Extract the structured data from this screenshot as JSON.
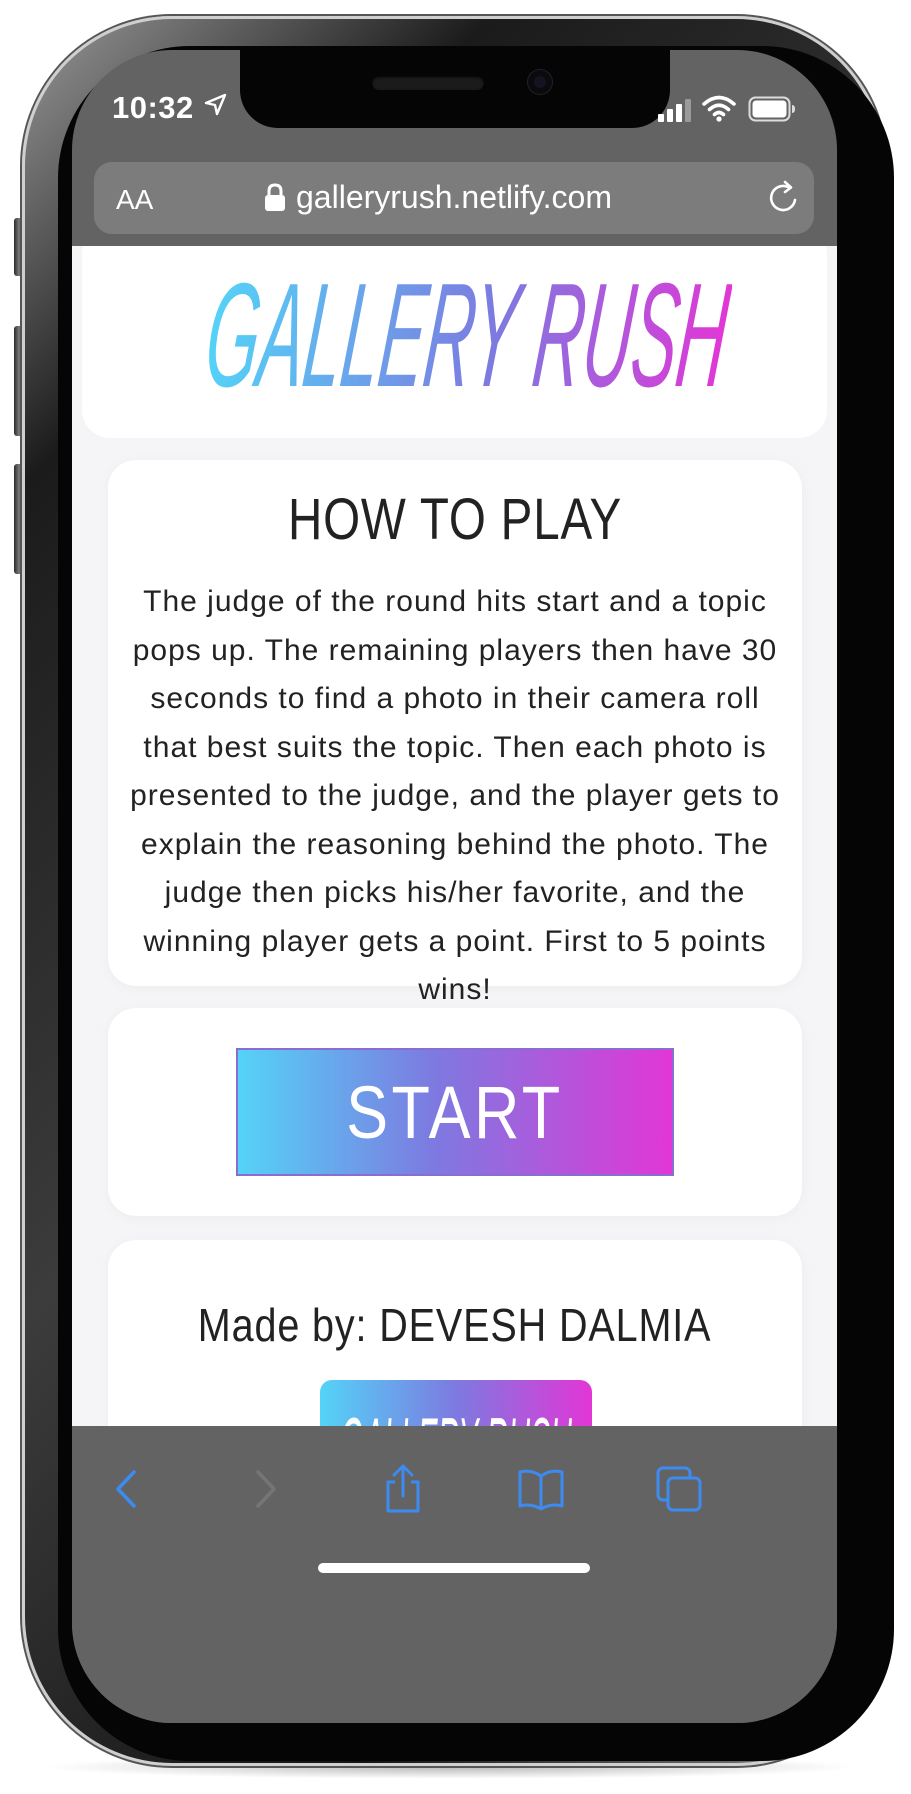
{
  "status_bar": {
    "time": "10:32"
  },
  "browser": {
    "text_size_label": "AA",
    "url": "galleryrush.netlify.com"
  },
  "site": {
    "logo_text": "GALLERY RUSH",
    "how_to_play": {
      "title": "HOW TO PLAY",
      "body": "The judge of the round hits start and a topic pops up. The remaining players then have 30 seconds to find a photo in their camera roll that best suits the topic. Then each photo is presented to the judge, and the player gets to explain the reasoning behind the photo. The judge then picks his/her favorite, and the winning player gets a point. First to 5 points wins!"
    },
    "start_label": "START",
    "credit": "Made by: DEVESH DALMIA",
    "mini_logo_text": "GALLERY RUSH"
  },
  "colors": {
    "gradient_start": "#54d3f7",
    "gradient_mid": "#7d7ae0",
    "gradient_end": "#e236d6",
    "toolbar_active": "#3d8bf0"
  },
  "toolbar": {
    "icons": [
      "back-icon",
      "forward-icon",
      "share-icon",
      "bookmarks-icon",
      "tabs-icon"
    ]
  }
}
